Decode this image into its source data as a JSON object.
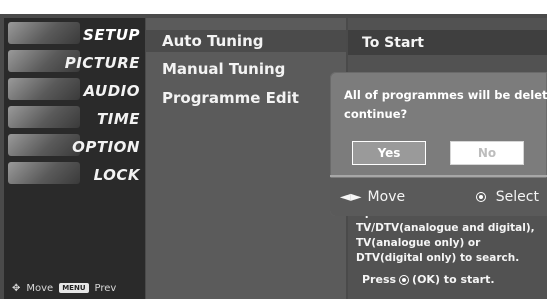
{
  "left_menu": {
    "items": [
      {
        "label": "SETUP",
        "icon": "tv-setup-icon",
        "selected": true
      },
      {
        "label": "PICTURE",
        "icon": "picture-icon",
        "selected": false
      },
      {
        "label": "AUDIO",
        "icon": "audio-icon",
        "selected": false
      },
      {
        "label": "TIME",
        "icon": "clock-icon",
        "selected": false
      },
      {
        "label": "OPTION",
        "icon": "option-icon",
        "selected": false
      },
      {
        "label": "LOCK",
        "icon": "lock-icon",
        "selected": false
      }
    ],
    "footer": {
      "move_label": "Move",
      "menu_badge": "MENU",
      "prev_label": "Prev"
    }
  },
  "submenu": {
    "items": [
      {
        "label": "Auto Tuning",
        "selected": true
      },
      {
        "label": "Manual Tuning",
        "selected": false
      },
      {
        "label": "Programme Edit",
        "selected": false
      }
    ]
  },
  "right_panel": {
    "header": "To Start",
    "help_text": "Option: Select TV/DTV(analogue and digital), TV(analogue only) or DTV(digital only) to search.",
    "press_prefix": "Press",
    "press_suffix": "(OK) to start."
  },
  "dialog": {
    "line1": "All of programmes will be deleted",
    "line2": "continue?",
    "yes_label": "Yes",
    "no_label": "No",
    "move_label": "Move",
    "select_label": "Select"
  },
  "colors": {
    "background": "#4a4a4a",
    "accent": "#ffffff"
  }
}
